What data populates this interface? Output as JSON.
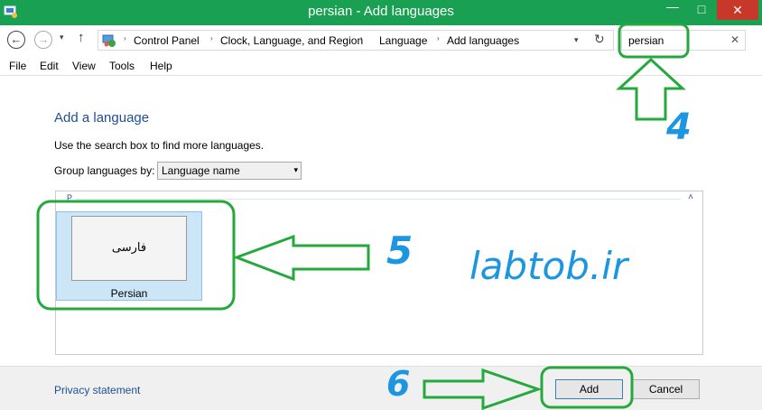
{
  "window": {
    "title": "persian - Add languages",
    "minimize_glyph": "—",
    "maximize_glyph": "□",
    "close_glyph": "✕"
  },
  "nav": {
    "back_glyph": "←",
    "forward_glyph": "→",
    "recent_glyph": "▾",
    "up_glyph": "↑",
    "address_dropdown_glyph": "▾",
    "refresh_glyph": "↻"
  },
  "address_bar": {
    "breadcrumbs": [
      "Control Panel",
      "Clock, Language, and Region",
      "Language",
      "Add languages"
    ],
    "separator_glyph": "›"
  },
  "search": {
    "value": "persian",
    "clear_glyph": "✕"
  },
  "menu": {
    "items": [
      "File",
      "Edit",
      "View",
      "Tools",
      "Help"
    ]
  },
  "main": {
    "heading": "Add a language",
    "hint": "Use the search box to find more languages.",
    "group_by_label": "Group languages by:",
    "group_by_value": "Language name",
    "group_by_arrow": "▾",
    "group_header": "P",
    "collapse_glyph": "˄"
  },
  "languages": [
    {
      "native": "فارسی",
      "name": "Persian"
    }
  ],
  "footer": {
    "privacy_link": "Privacy statement",
    "add_label": "Add",
    "cancel_label": "Cancel"
  },
  "annotations": {
    "step_search": "4",
    "step_select": "5",
    "step_add": "6",
    "watermark": "labtob.ir",
    "color": "#25a93c",
    "label_color": "#1c96e0"
  },
  "colors": {
    "titlebar": "#1aa053",
    "close": "#c7382a",
    "link": "#1e4e96",
    "tile_selected": "#cce5f7"
  }
}
